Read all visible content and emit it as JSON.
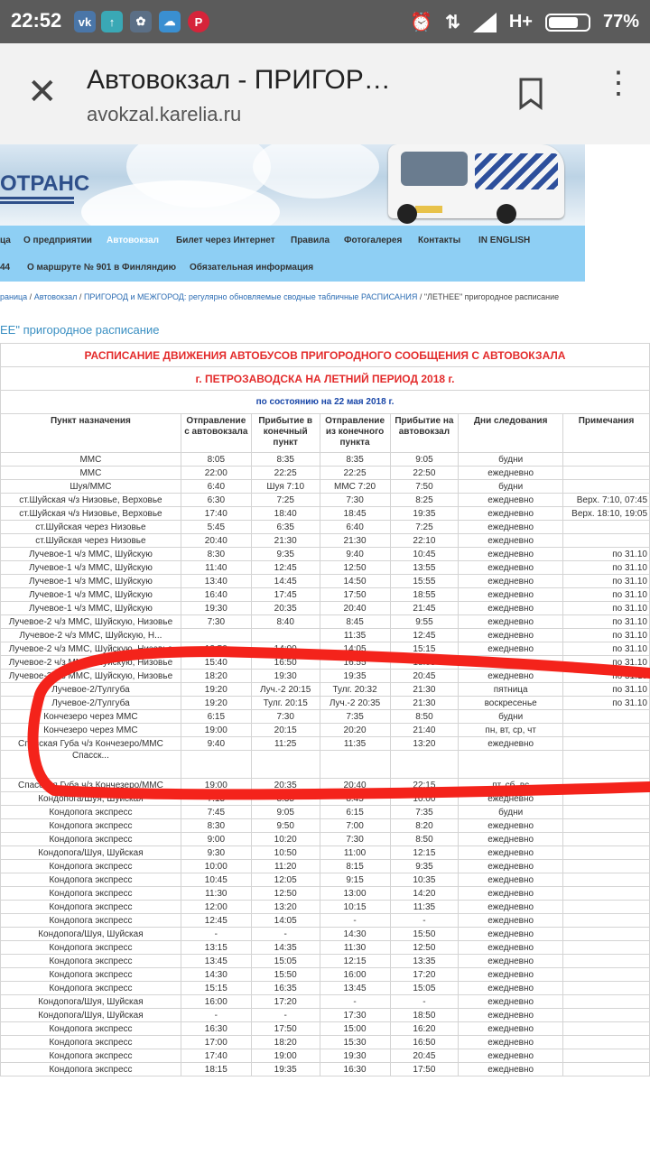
{
  "status_bar": {
    "time": "22:52",
    "network": "H+",
    "battery": "77%",
    "battery_level": 0.77,
    "app_icons": [
      "vk-icon",
      "upload-icon",
      "settings-icon",
      "cloud-icon",
      "pinterest-icon"
    ]
  },
  "toolbar": {
    "title": "Автовокзал - ПРИГОР…",
    "url": "avokzal.karelia.ru"
  },
  "banner": {
    "logo_text": "ОТРАНС"
  },
  "nav": {
    "row1": [
      "ца",
      "О предприятии",
      "Автовокзал",
      "Билет через Интернет",
      "Правила",
      "Фотогалерея",
      "Контакты",
      "IN ENGLISH"
    ],
    "row2": [
      "44",
      "О маршруте № 901 в Финляндию",
      "Обязательная информация"
    ],
    "active": "Автовокзал"
  },
  "breadcrumb": {
    "home": "раница",
    "sep1": " / ",
    "section": "Автовокзал",
    "sep2": " / ",
    "subsection": "ПРИГОРОД и МЕЖГОРОД: регулярно обновляемые сводные табличные РАСПИСАНИЯ",
    "current": " / \"ЛЕТНЕЕ\" пригородное расписание"
  },
  "page_heading": "ЕЕ\" пригородное расписание",
  "schedule": {
    "title1": "РАСПИСАНИЕ ДВИЖЕНИЯ АВТОБУСОВ ПРИГОРОДНОГО СООБЩЕНИЯ С АВТОВОКЗАЛА",
    "title2": "г. ПЕТРОЗАВОДСКА НА ЛЕТНИЙ ПЕРИОД 2018 г.",
    "status_date": "по состоянию на 22 мая 2018 г.",
    "columns": [
      "Пункт назначения",
      "Отправление с автовокзала",
      "Прибытие в конечный пункт",
      "Отправление из конечного пункта",
      "Прибытие на автовокзал",
      "Дни следования",
      "Примечания"
    ],
    "rows": [
      [
        "ММС",
        "8:05",
        "8:35",
        "8:35",
        "9:05",
        "будни",
        ""
      ],
      [
        "ММС",
        "22:00",
        "22:25",
        "22:25",
        "22:50",
        "ежедневно",
        ""
      ],
      [
        "Шуя/ММС",
        "6:40",
        "Шуя 7:10",
        "ММС  7:20",
        "7:50",
        "будни",
        ""
      ],
      [
        "ст.Шуйская ч/з Низовье, Верховье",
        "6:30",
        "7:25",
        "7:30",
        "8:25",
        "ежедневно",
        "Верх. 7:10, 07:45"
      ],
      [
        "ст.Шуйская ч/з Низовье, Верховье",
        "17:40",
        "18:40",
        "18:45",
        "19:35",
        "ежедневно",
        "Верх. 18:10, 19:05"
      ],
      [
        "ст.Шуйская через Низовье",
        "5:45",
        "6:35",
        "6:40",
        "7:25",
        "ежедневно",
        ""
      ],
      [
        "ст.Шуйская через Низовье",
        "20:40",
        "21:30",
        "21:30",
        "22:10",
        "ежедневно",
        ""
      ],
      [
        "Лучевое-1 ч/з ММС, Шуйскую",
        "8:30",
        "9:35",
        "9:40",
        "10:45",
        "ежедневно",
        "по 31.10"
      ],
      [
        "Лучевое-1 ч/з ММС, Шуйскую",
        "11:40",
        "12:45",
        "12:50",
        "13:55",
        "ежедневно",
        "по 31.10"
      ],
      [
        "Лучевое-1 ч/з ММС, Шуйскую",
        "13:40",
        "14:45",
        "14:50",
        "15:55",
        "ежедневно",
        "по 31.10"
      ],
      [
        "Лучевое-1 ч/з ММС, Шуйскую",
        "16:40",
        "17:45",
        "17:50",
        "18:55",
        "ежедневно",
        "по 31.10"
      ],
      [
        "Лучевое-1 ч/з ММС, Шуйскую",
        "19:30",
        "20:35",
        "20:40",
        "21:45",
        "ежедневно",
        "по 31.10"
      ],
      [
        "Лучевое-2 ч/з ММС, Шуйскую, Низовье",
        "7:30",
        "8:40",
        "8:45",
        "9:55",
        "ежедневно",
        "по 31.10"
      ],
      [
        "Лучевое-2 ч/з ММС, Шуйскую, Н...",
        "",
        "",
        "11:35",
        "12:45",
        "ежедневно",
        "по 31.10"
      ],
      [
        "Лучевое-2 ч/з ММС, Шуйскую, Низовье",
        "12:50",
        "14:00",
        "14:05",
        "15:15",
        "ежедневно",
        "по 31.10"
      ],
      [
        "Лучевое-2 ч/з ММС, Шуйскую, Низовье",
        "15:40",
        "16:50",
        "16:55",
        "18:05",
        "ежедневно",
        "по 31.10"
      ],
      [
        "Лучевое-2 ч/з ММС, Шуйскую, Низовье",
        "18:20",
        "19:30",
        "19:35",
        "20:45",
        "ежедневно",
        "по 31.10"
      ],
      [
        "Лучевое-2/Тулгуба",
        "19:20",
        "Луч.-2 20:15",
        "Тулг. 20:32",
        "21:30",
        "пятница",
        "по 31.10"
      ],
      [
        "Лучевое-2/Тулгуба",
        "19:20",
        "Тулг. 20:15",
        "Луч.-2 20:35",
        "21:30",
        "воскресенье",
        "по 31.10"
      ],
      [
        "Кончезеро через ММС",
        "6:15",
        "7:30",
        "7:35",
        "8:50",
        "будни",
        ""
      ],
      [
        "Кончезеро через ММС",
        "19:00",
        "20:15",
        "20:20",
        "21:40",
        "пн, вт, ср, чт",
        ""
      ],
      [
        "Спасская Губа ч/з Кончезеро/ММС",
        "9:40",
        "11:25",
        "11:35",
        "13:20",
        "ежедневно",
        ""
      ],
      [
        "Спасск...",
        "",
        "",
        "",
        "",
        "",
        ""
      ],
      [
        "Спасская Губа ч/з Кончезеро/ММС",
        "19:00",
        "20:35",
        "20:40",
        "22:15",
        "пт, сб, вс",
        ""
      ],
      [
        "Кондопога/Шуя, Шуйская",
        "7:15",
        "8:35",
        "8:45",
        "10:00",
        "ежедневно",
        ""
      ],
      [
        "Кондопога экспресс",
        "7:45",
        "9:05",
        "6:15",
        "7:35",
        "будни",
        ""
      ],
      [
        "Кондопога экспресс",
        "8:30",
        "9:50",
        "7:00",
        "8:20",
        "ежедневно",
        ""
      ],
      [
        "Кондопога экспресс",
        "9:00",
        "10:20",
        "7:30",
        "8:50",
        "ежедневно",
        ""
      ],
      [
        "Кондопога/Шуя, Шуйская",
        "9:30",
        "10:50",
        "11:00",
        "12:15",
        "ежедневно",
        ""
      ],
      [
        "Кондопога экспресс",
        "10:00",
        "11:20",
        "8:15",
        "9:35",
        "ежедневно",
        ""
      ],
      [
        "Кондопога экспресс",
        "10:45",
        "12:05",
        "9:15",
        "10:35",
        "ежедневно",
        ""
      ],
      [
        "Кондопога экспресс",
        "11:30",
        "12:50",
        "13:00",
        "14:20",
        "ежедневно",
        ""
      ],
      [
        "Кондопога экспресс",
        "12:00",
        "13:20",
        "10:15",
        "11:35",
        "ежедневно",
        ""
      ],
      [
        "Кондопога экспресс",
        "12:45",
        "14:05",
        "-",
        "-",
        "ежедневно",
        ""
      ],
      [
        "Кондопога/Шуя, Шуйская",
        "-",
        "-",
        "14:30",
        "15:50",
        "ежедневно",
        ""
      ],
      [
        "Кондопога экспресс",
        "13:15",
        "14:35",
        "11:30",
        "12:50",
        "ежедневно",
        ""
      ],
      [
        "Кондопога экспресс",
        "13:45",
        "15:05",
        "12:15",
        "13:35",
        "ежедневно",
        ""
      ],
      [
        "Кондопога экспресс",
        "14:30",
        "15:50",
        "16:00",
        "17:20",
        "ежедневно",
        ""
      ],
      [
        "Кондопога экспресс",
        "15:15",
        "16:35",
        "13:45",
        "15:05",
        "ежедневно",
        ""
      ],
      [
        "Кондопога/Шуя, Шуйская",
        "16:00",
        "17:20",
        "-",
        "-",
        "ежедневно",
        ""
      ],
      [
        "Кондопога/Шуя, Шуйская",
        "-",
        "-",
        "17:30",
        "18:50",
        "ежедневно",
        ""
      ],
      [
        "Кондопога экспресс",
        "16:30",
        "17:50",
        "15:00",
        "16:20",
        "ежедневно",
        ""
      ],
      [
        "Кондопога экспресс",
        "17:00",
        "18:20",
        "15:30",
        "16:50",
        "ежедневно",
        ""
      ],
      [
        "Кондопога экспресс",
        "17:40",
        "19:00",
        "19:30",
        "20:45",
        "ежедневно",
        ""
      ],
      [
        "Кондопога экспресс",
        "18:15",
        "19:35",
        "16:30",
        "17:50",
        "ежедневно",
        ""
      ]
    ]
  },
  "annotation": {
    "color": "#f4231b"
  }
}
